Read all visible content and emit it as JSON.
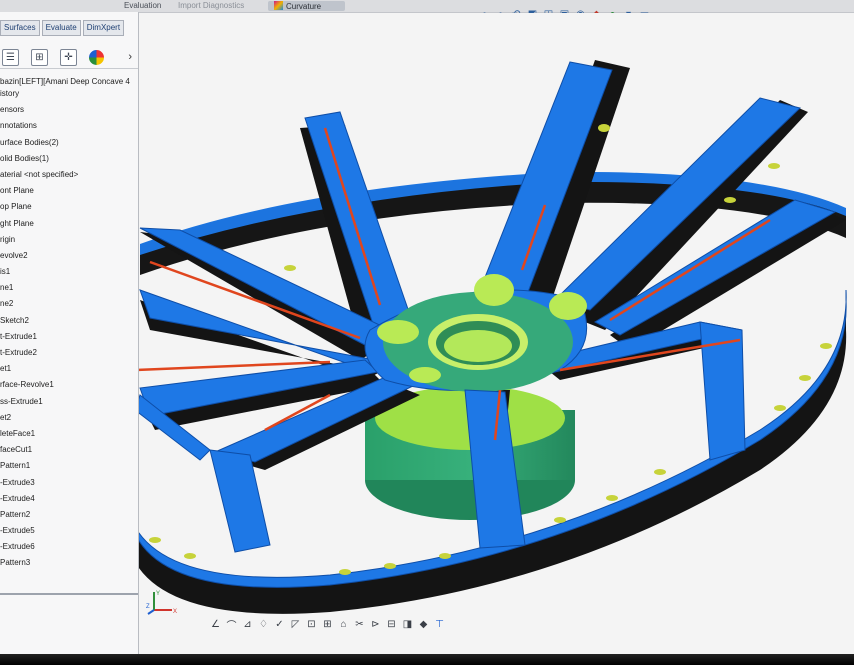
{
  "ribbon": {
    "tabs": [
      "Evaluation",
      "Import Diagnostics",
      "Curvature"
    ],
    "active": "Curvature"
  },
  "command_manager": {
    "tabs": [
      "Surfaces",
      "Evaluate",
      "DimXpert"
    ]
  },
  "property_tabs": {
    "icons": [
      "feature-tree-icon",
      "property-manager-icon",
      "configuration-manager-icon",
      "appearance-icon"
    ],
    "more": "›"
  },
  "feature_tree": {
    "root": "bazin[LEFT][Amani Deep Concave 4",
    "items": [
      "istory",
      "ensors",
      "nnotations",
      "urface Bodies(2)",
      "olid Bodies(1)",
      "aterial <not specified>",
      "ont Plane",
      "op Plane",
      "ght Plane",
      "rigin",
      "evolve2",
      "is1",
      "ne1",
      "ne2",
      "Sketch2",
      "t-Extrude1",
      "t-Extrude2",
      "et1",
      "rface-Revolve1",
      "ss-Extrude1",
      "et2",
      "leteFace1",
      "faceCut1",
      "Pattern1",
      "-Extrude3",
      "-Extrude4",
      "Pattern2",
      "-Extrude5",
      "-Extrude6",
      "Pattern3"
    ]
  },
  "view_toolbar": [
    "zoom-to-fit-icon",
    "zoom-to-area-icon",
    "previous-view-icon",
    "section-view-icon",
    "view-orientation-icon",
    "display-style-icon",
    "hide-show-icon",
    "edit-appearance-icon",
    "apply-scene-icon",
    "view-settings-icon",
    "monitor-icon"
  ],
  "bottom_toolbar": [
    "sketch-line-icon",
    "arc-icon",
    "dimension-icon",
    "relation-icon",
    "fillet-icon",
    "chamfer-icon",
    "mirror-icon",
    "pattern-icon",
    "offset-icon",
    "trim-icon",
    "extend-icon",
    "convert-icon",
    "smart-dimension-icon",
    "display-icon",
    "sketch-icon"
  ],
  "triad": {
    "x_label": "X",
    "y_label": "Y",
    "z_label": "Z"
  },
  "colors": {
    "model_blue": "#1e78e6",
    "model_dark": "#141414",
    "hub_green": "#2fa775",
    "hub_lime": "#a7e24a",
    "edge_red": "#e0461e",
    "accent_yellow": "#e6d24a"
  }
}
